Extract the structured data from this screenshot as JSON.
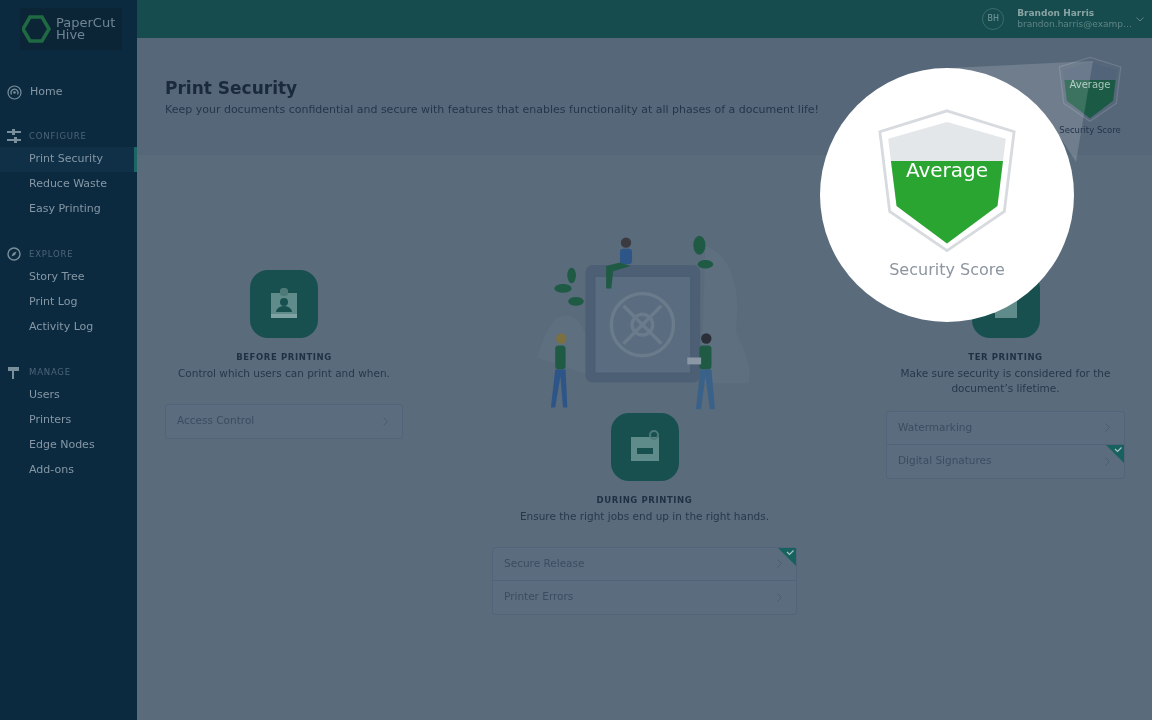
{
  "brand": {
    "name": "PaperCut",
    "product": "Hive"
  },
  "sidebar": {
    "home": {
      "label": "Home"
    },
    "sections": [
      {
        "title": "CONFIGURE",
        "items": [
          {
            "label": "Print Security",
            "selected": true
          },
          {
            "label": "Reduce Waste",
            "selected": false
          },
          {
            "label": "Easy Printing",
            "selected": false
          }
        ]
      },
      {
        "title": "EXPLORE",
        "items": [
          {
            "label": "Story Tree",
            "selected": false
          },
          {
            "label": "Print Log",
            "selected": false
          },
          {
            "label": "Activity Log",
            "selected": false
          }
        ]
      },
      {
        "title": "MANAGE",
        "items": [
          {
            "label": "Users",
            "selected": false
          },
          {
            "label": "Printers",
            "selected": false
          },
          {
            "label": "Edge Nodes",
            "selected": false
          },
          {
            "label": "Add-ons",
            "selected": false
          }
        ]
      }
    ]
  },
  "user": {
    "initials": "BH",
    "name": "Brandon Harris",
    "email": "brandon.harris@examp…"
  },
  "page": {
    "title": "Print Security",
    "subtitle": "Keep your documents confidential and secure with features that enables functionality at all phases of a document life!"
  },
  "score_badge": {
    "rating": "Average",
    "label": "Security Score",
    "level": 0.68
  },
  "phases": [
    {
      "kind": "before",
      "label": "BEFORE PRINTING",
      "description": "Control which users can print and when.",
      "options": [
        {
          "label": "Access Control",
          "enabled": false
        }
      ]
    },
    {
      "kind": "during",
      "label": "DURING PRINTING",
      "description": "Ensure the right jobs end up in the right hands.",
      "options": [
        {
          "label": "Secure Release",
          "enabled": true
        },
        {
          "label": "Printer Errors",
          "enabled": false
        }
      ]
    },
    {
      "kind": "after",
      "label": "TER PRINTING",
      "description": "Make sure security is considered for the document’s lifetime.",
      "options": [
        {
          "label": "Watermarking",
          "enabled": false
        },
        {
          "label": "Digital Signatures",
          "enabled": true
        }
      ]
    }
  ],
  "spotlight": {
    "rating": "Average",
    "label": "Security Score",
    "level": 0.68
  }
}
